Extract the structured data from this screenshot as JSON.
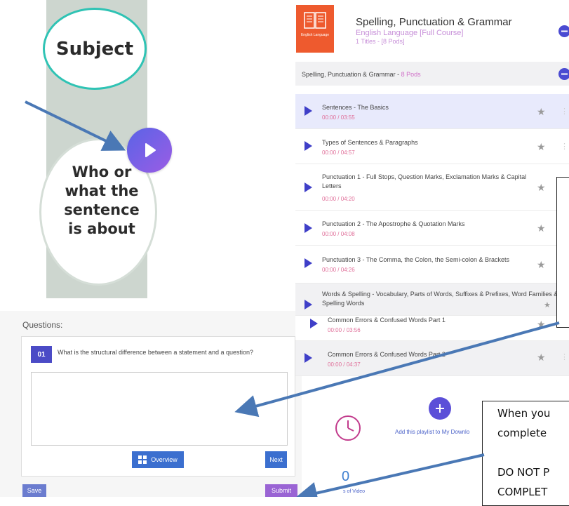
{
  "video": {
    "subject_label": "Subject",
    "about_lines": [
      "Who or",
      "what the",
      "sentence",
      "is about"
    ]
  },
  "questions": {
    "title": "Questions:",
    "number": "01",
    "question_text": "What is the structural difference between a statement and a question?",
    "answer_value": "",
    "overview_label": "Overview",
    "next_label": "Next",
    "save_label": "Save",
    "submit_label": "Submit"
  },
  "course": {
    "thumb_label": "English Language",
    "title": "Spelling, Punctuation & Grammar",
    "subtitle": "English Language [Full Course]",
    "meta": "1 Titles - [8 Pods]",
    "section_name": "Spelling, Punctuation & Grammar - ",
    "section_pods": "8 Pods"
  },
  "pods": [
    {
      "title": "Sentences - The Basics",
      "time": "00:00 / 03:55"
    },
    {
      "title": "Types of Sentences & Paragraphs",
      "time": "00:00 / 04:57"
    },
    {
      "title": "Punctuation 1 - Full Stops, Question Marks, Exclamation Marks & Capital Letters",
      "time": "00:00 / 04:20"
    },
    {
      "title": "Punctuation 2 - The Apostrophe & Quotation Marks",
      "time": "00:00 / 04:08"
    },
    {
      "title": "Punctuation 3 - The Comma, the Colon, the Semi-colon & Brackets",
      "time": "00:00 / 04:26"
    },
    {
      "title": "Words & Spelling - Vocabulary, Parts of Words, Suffixes & Prefixes, Word Families & Spelling Words",
      "time": ""
    },
    {
      "title": "Common Errors & Confused Words Part 1",
      "time": "00:00 / 03:56"
    },
    {
      "title": "Common Errors & Confused Words Part 2",
      "time": "00:00 / 04:37"
    }
  ],
  "playlist": {
    "add_label": "Add this playlist to My Downlo",
    "count_value": "0",
    "count_label": "s of Video"
  },
  "callout": {
    "lines": [
      "When you",
      "complete",
      "",
      "DO NOT P",
      "COMPLET"
    ]
  },
  "colors": {
    "accent": "#4b4bc6",
    "course_orange": "#ee5a2e",
    "pink_text": "#e0709a",
    "teal_ring": "#2fc3b4",
    "arrow_blue": "#4a78b5"
  }
}
